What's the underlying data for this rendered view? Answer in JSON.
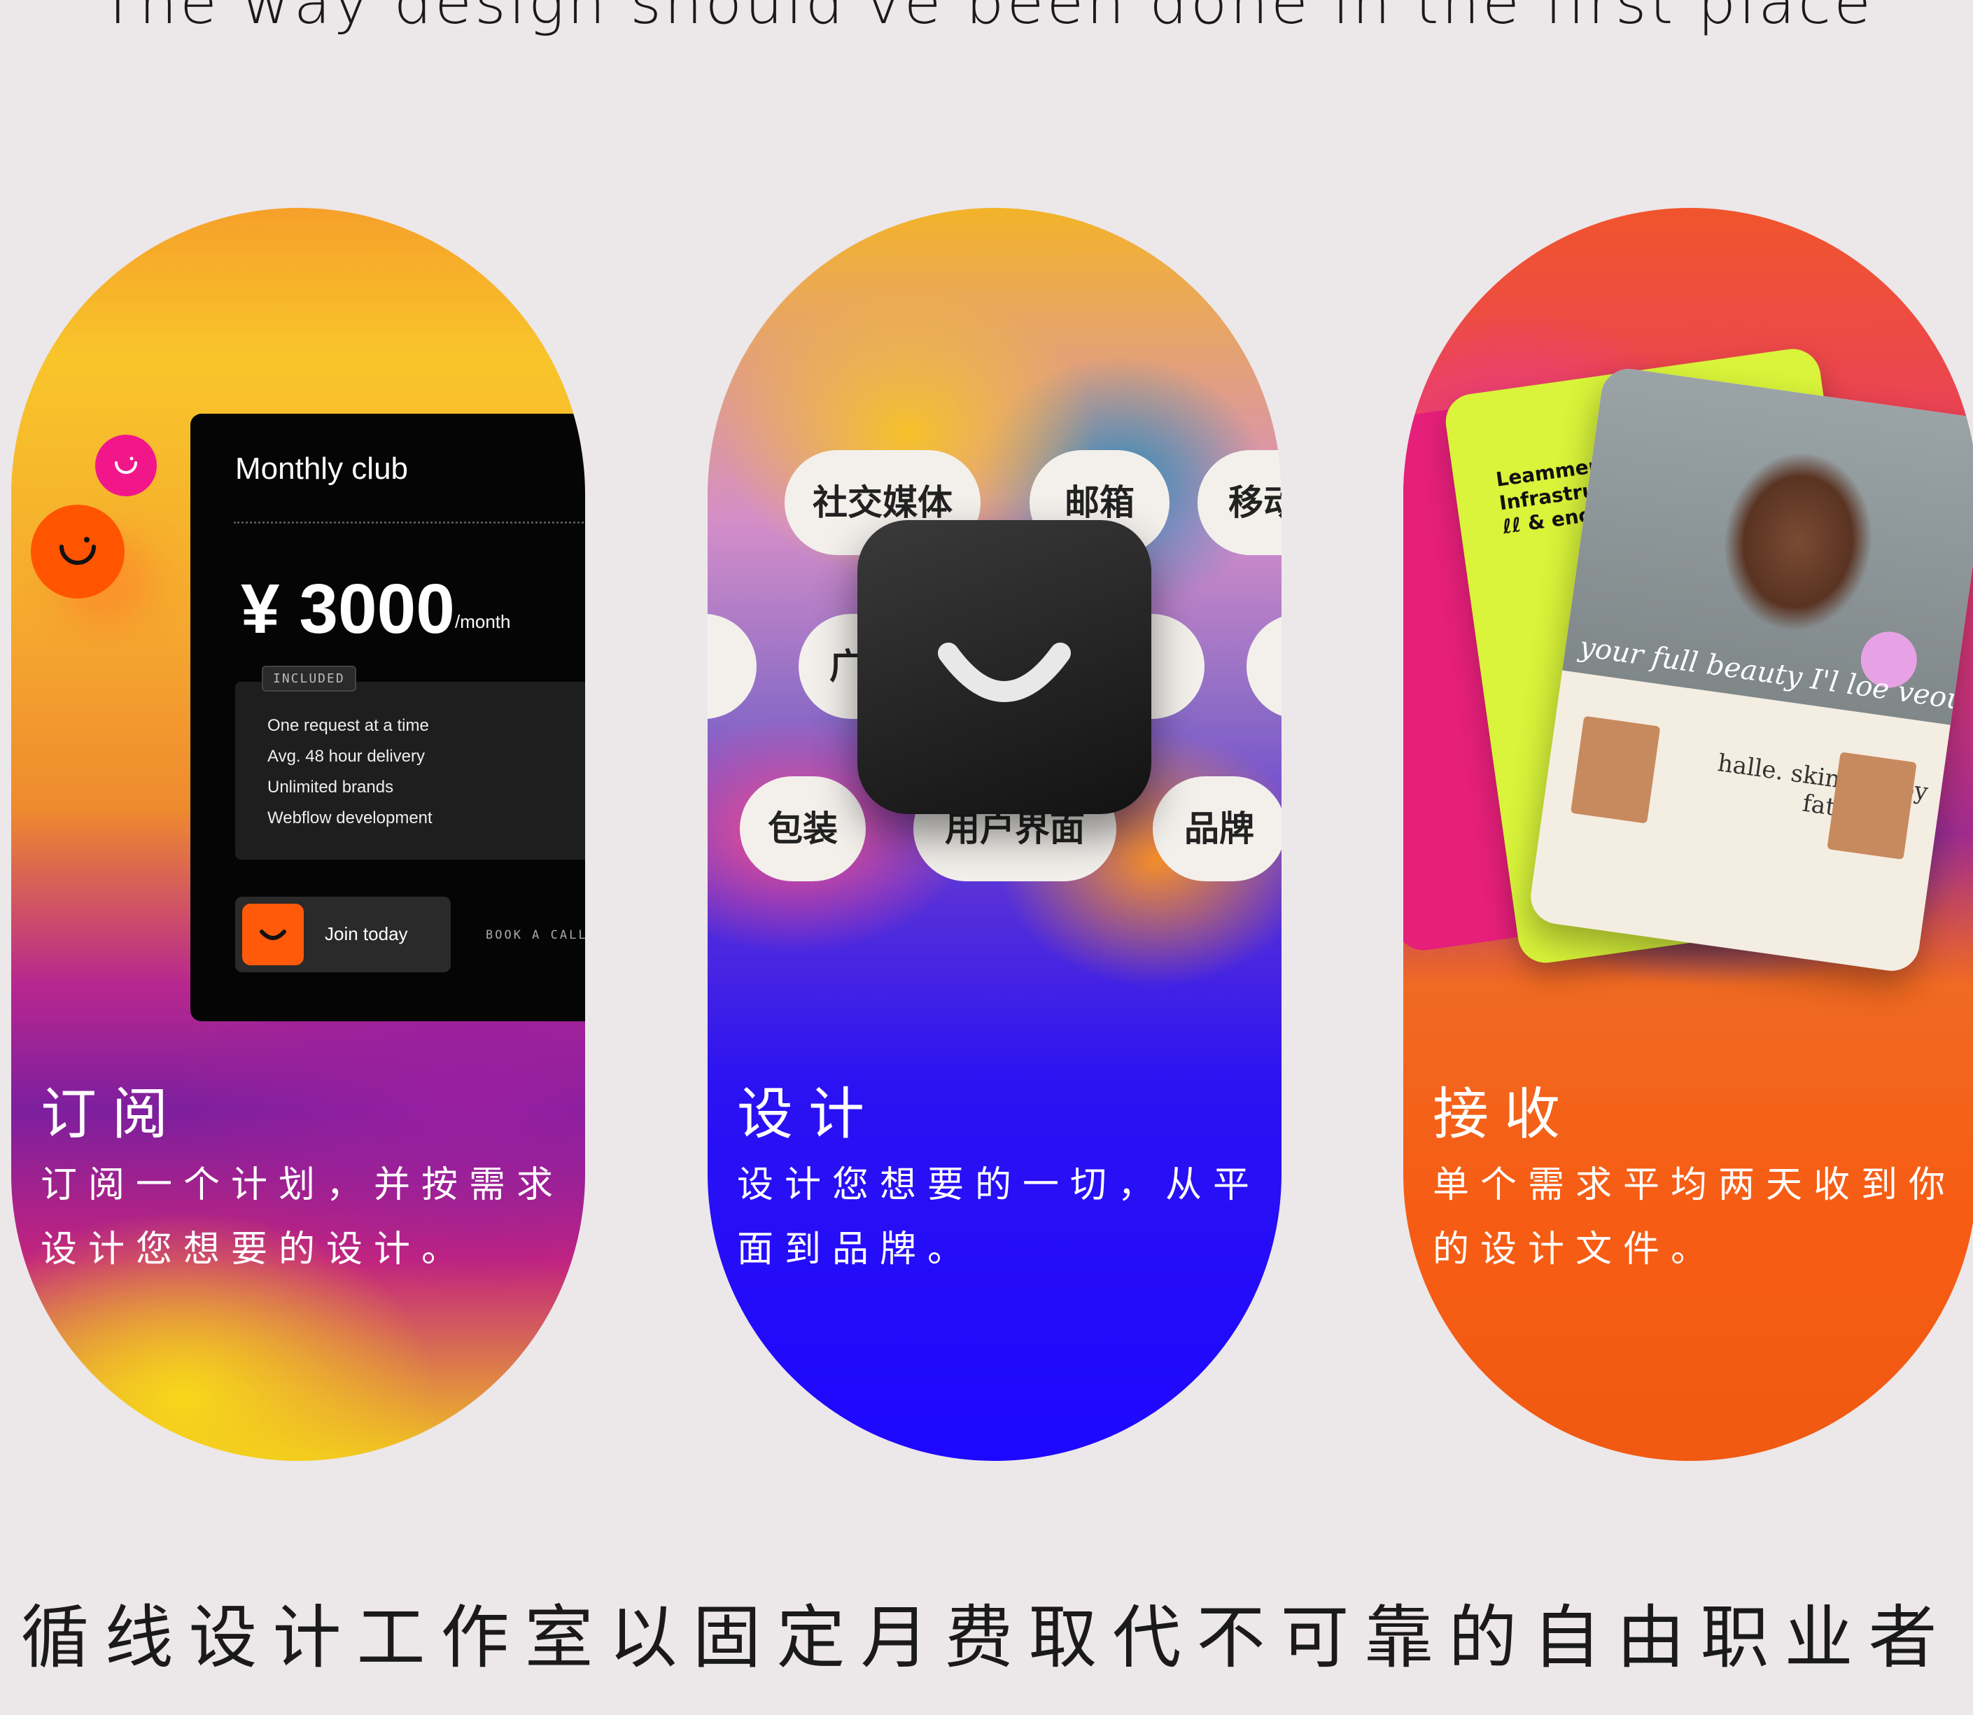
{
  "headline": "The way design should've been done in the first place",
  "footer": "循线设计工作室以固定月费取代不可靠的自由职业者",
  "cards": [
    {
      "title": "订阅",
      "description": "订阅一个计划，并按需求设计您想要的设计。",
      "plan": {
        "name": "Monthly club",
        "price": "¥ 3000",
        "price_unit": "/month",
        "included_tag": "INCLUDED",
        "features": [
          "One request at a time",
          "Avg. 48 hour delivery",
          "Unlimited brands",
          "Webflow development"
        ],
        "join_label": "Join today",
        "book_call": "BOOK A CALL"
      }
    },
    {
      "title": "设计",
      "description": "设计您想要的一切，从平面到品牌。",
      "chips": [
        "社交媒体",
        "邮箱",
        "移动",
        "广",
        "包装",
        "用户界面",
        "品牌"
      ]
    },
    {
      "title": "接收",
      "description": "单个需求平均两天收到你的设计文件。",
      "mockup": {
        "green_heading": "Leammerce Infrastructure for ℓℓ & enoes",
        "script_text": "your full beauty I'l loe veouty",
        "subhead": "halle. skin. happy fat"
      }
    }
  ],
  "colors": {
    "accent_orange": "#ff5a0a",
    "accent_pink": "#f2168b",
    "card_black": "#050505"
  }
}
